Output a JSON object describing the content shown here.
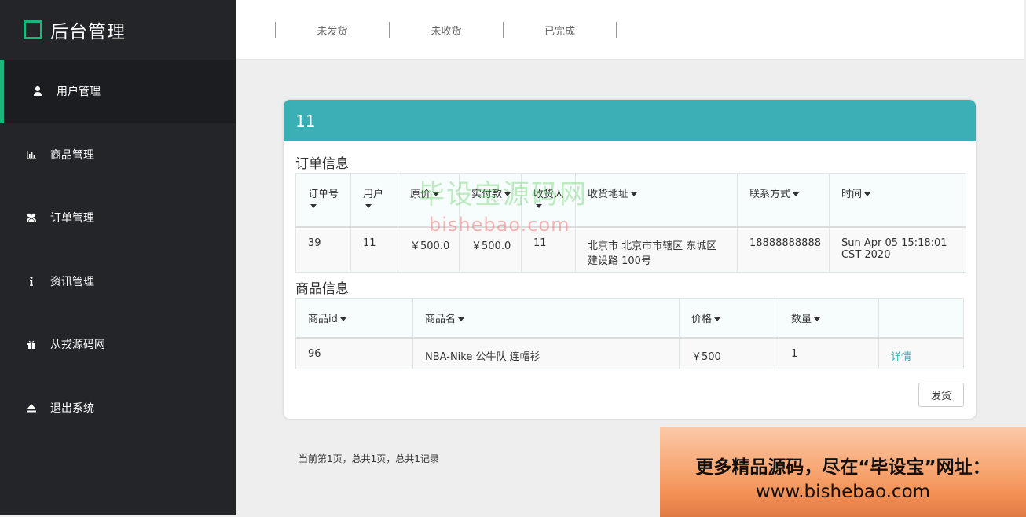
{
  "brand": {
    "title": "后台管理"
  },
  "sidebar": {
    "items": [
      {
        "label": "用户管理",
        "icon": "user-icon"
      },
      {
        "label": "商品管理",
        "icon": "bar-chart-icon"
      },
      {
        "label": "订单管理",
        "icon": "users-icon"
      },
      {
        "label": "资讯管理",
        "icon": "info-icon"
      },
      {
        "label": "从戎源码网",
        "icon": "gift-icon"
      },
      {
        "label": "退出系统",
        "icon": "eject-icon"
      }
    ]
  },
  "tabs": [
    "未发货",
    "未收货",
    "已完成"
  ],
  "card": {
    "title": "11",
    "order_section": "订单信息",
    "order_headers": [
      "订单号",
      "用户",
      "原价",
      "实付款",
      "收货人",
      "收货地址",
      "联系方式",
      "时间"
    ],
    "order_row": {
      "order_no": "39",
      "user": "11",
      "original_price": "￥500.0",
      "paid": "￥500.0",
      "receiver": "11",
      "address": "北京市 北京市市辖区 东城区 建设路 100号",
      "contact": "18888888888",
      "time": "Sun Apr 05 15:18:01 CST 2020"
    },
    "goods_section": "商品信息",
    "goods_headers": [
      "商品id",
      "商品名",
      "价格",
      "数量"
    ],
    "goods_row": {
      "id": "96",
      "name": "NBA-Nike 公牛队 连帽衫",
      "price": "￥500",
      "qty": "1",
      "action": "详情"
    },
    "ship_button": "发货"
  },
  "pagination": {
    "text": "当前第1页，总共1页，总共1记录"
  },
  "watermark": {
    "cn": "毕设宝源码网",
    "en": "bishebao.com"
  },
  "promo": {
    "line1": "更多精品源码，尽在“毕设宝”网址：",
    "line2": "www.bishebao.com"
  },
  "colors": {
    "accent": "#1ab77a",
    "header": "#3aafb4",
    "sidebar": "#242529"
  }
}
